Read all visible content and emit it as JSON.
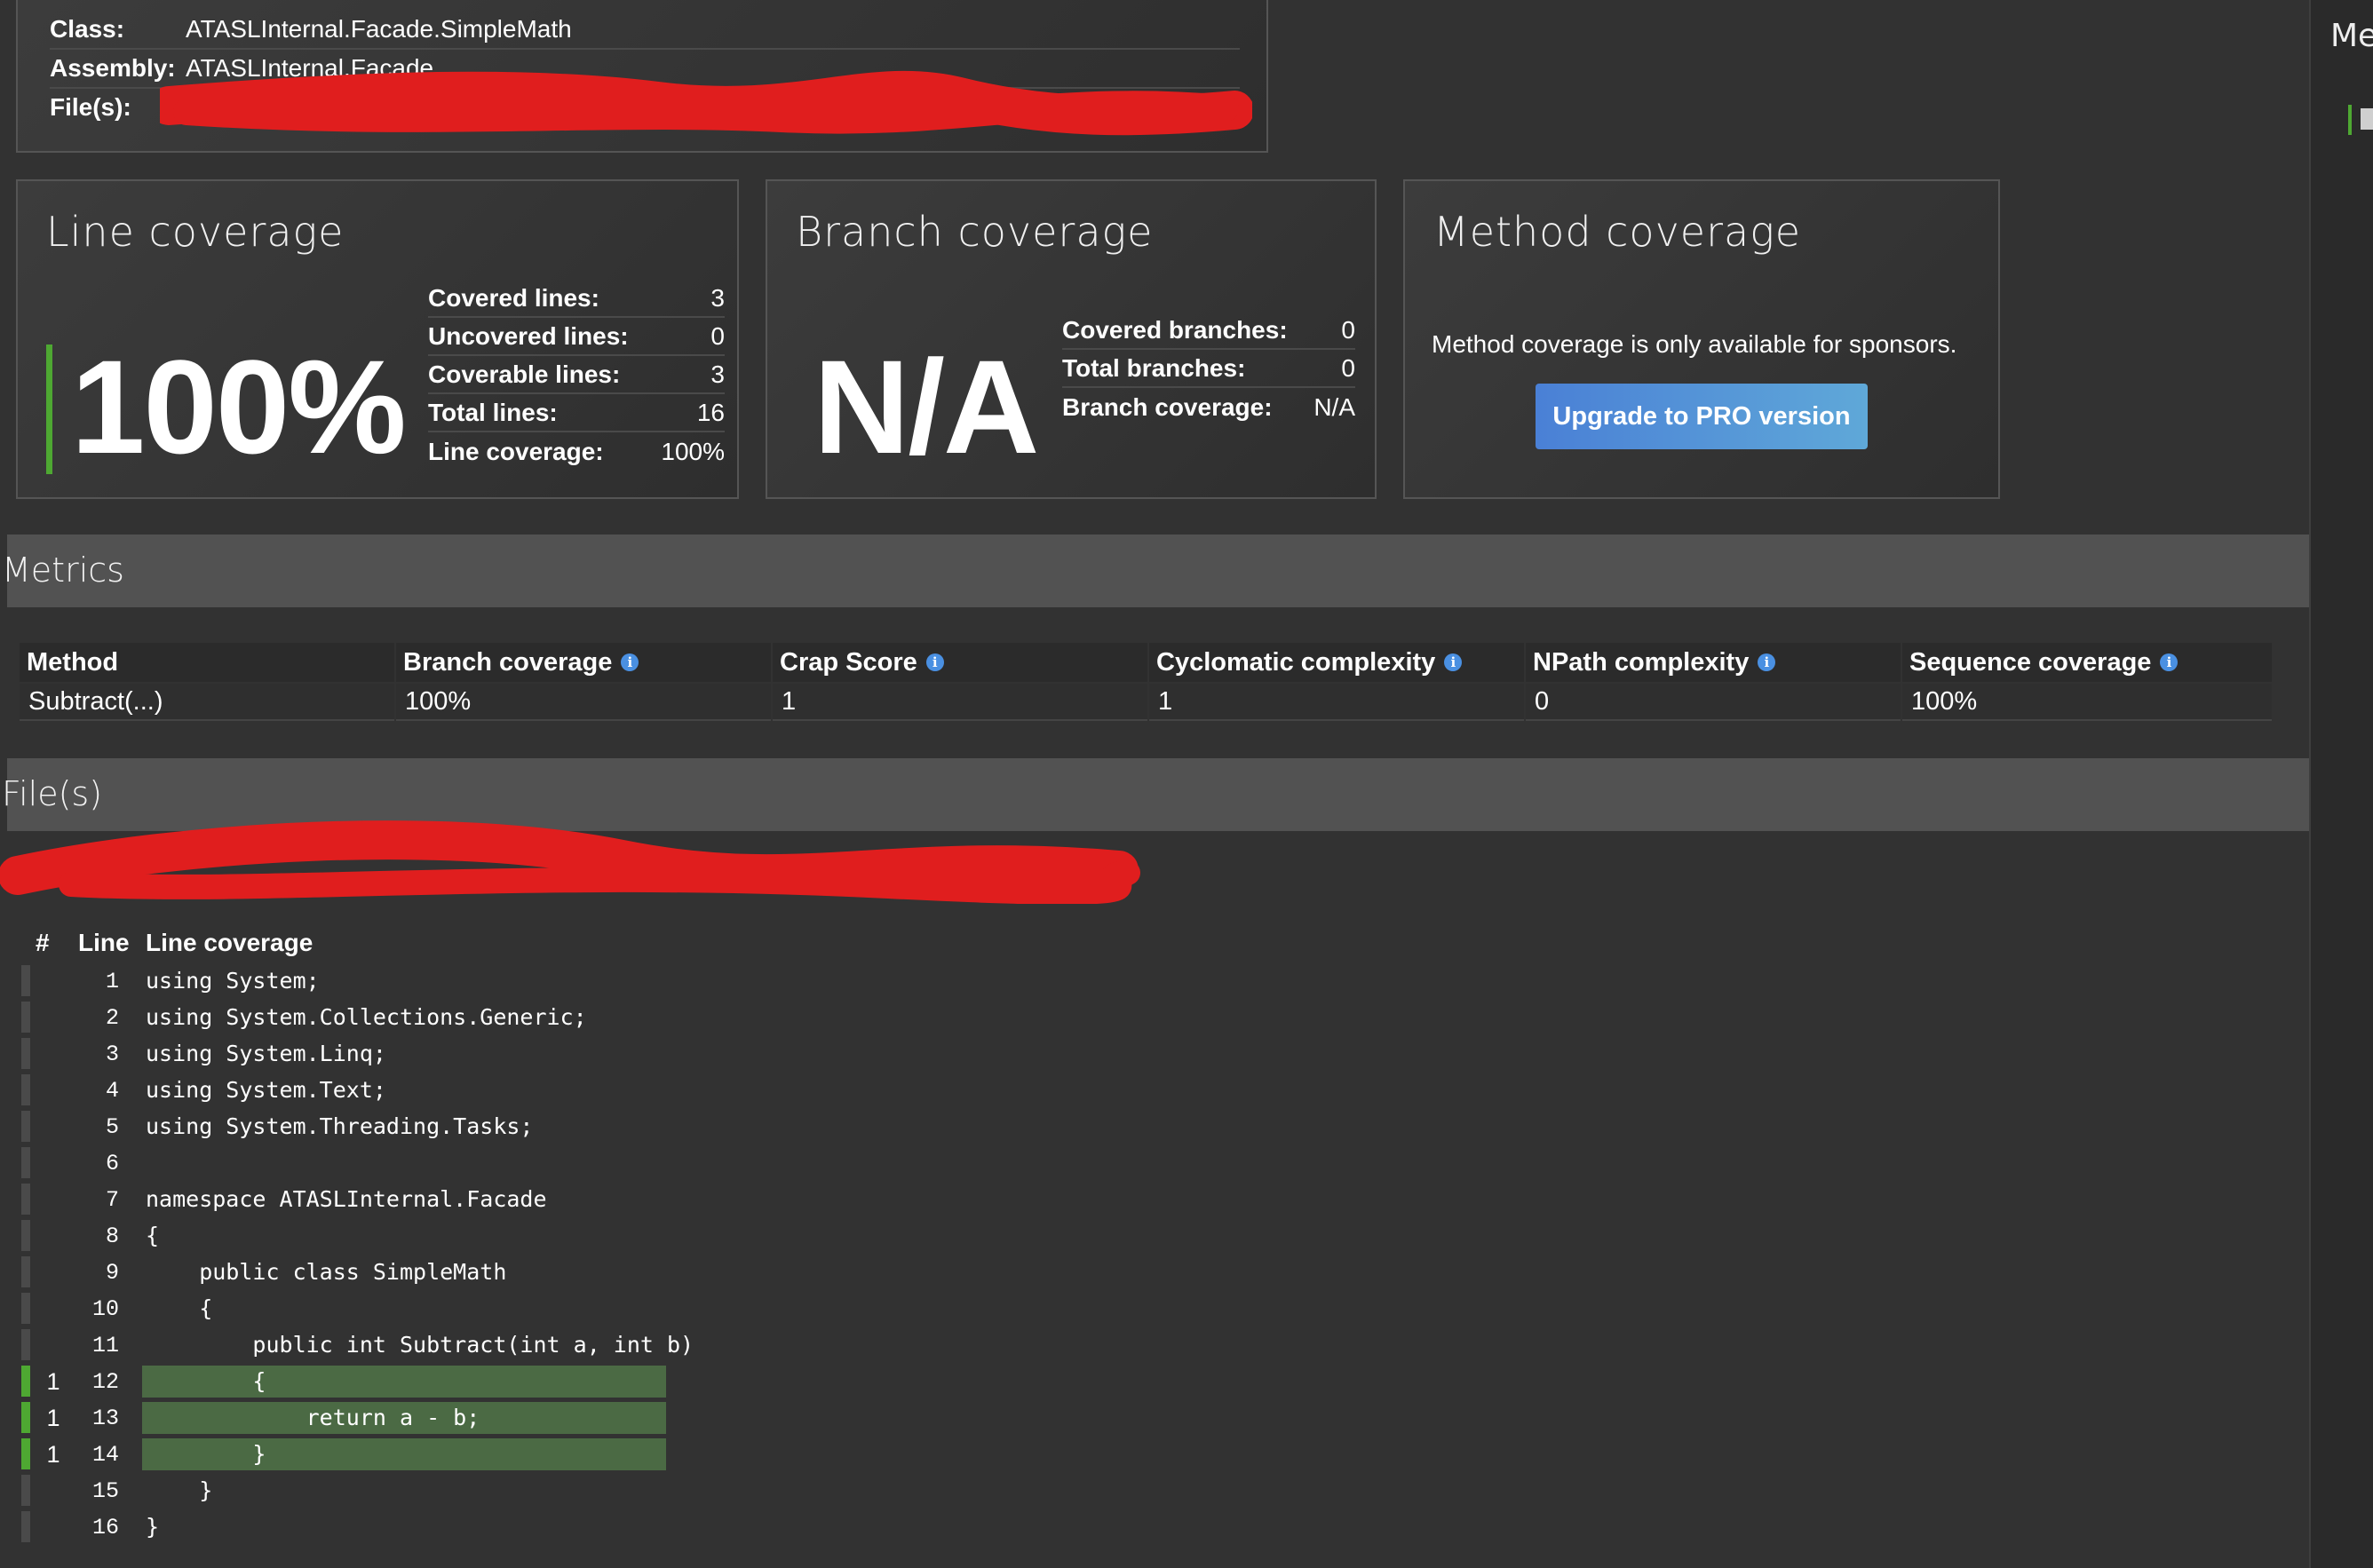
{
  "info": {
    "class_label": "Class:",
    "class_value": "ATASLInternal.Facade.SimpleMath",
    "assembly_label": "Assembly:",
    "assembly_value": "ATASLInternal.Facade",
    "files_label": "File(s):"
  },
  "line_coverage": {
    "title": "Line coverage",
    "big": "100%",
    "stats": [
      {
        "label": "Covered lines:",
        "value": "3"
      },
      {
        "label": "Uncovered lines:",
        "value": "0"
      },
      {
        "label": "Coverable lines:",
        "value": "3"
      },
      {
        "label": "Total lines:",
        "value": "16"
      },
      {
        "label": "Line coverage:",
        "value": "100%"
      }
    ]
  },
  "branch_coverage": {
    "title": "Branch coverage",
    "big": "N/A",
    "stats": [
      {
        "label": "Covered branches:",
        "value": "0"
      },
      {
        "label": "Total branches:",
        "value": "0"
      },
      {
        "label": "Branch coverage:",
        "value": "N/A"
      }
    ]
  },
  "method_coverage": {
    "title": "Method coverage",
    "message": "Method coverage is only available for sponsors.",
    "upgrade_button": "Upgrade to PRO version"
  },
  "metrics": {
    "section_title": "Metrics",
    "headers": [
      "Method",
      "Branch coverage",
      "Crap Score",
      "Cyclomatic complexity",
      "NPath complexity",
      "Sequence coverage"
    ],
    "rows": [
      [
        "Subtract(...)",
        "100%",
        "1",
        "1",
        "0",
        "100%"
      ]
    ]
  },
  "files": {
    "section_title": "File(s)",
    "col_hash": "#",
    "col_line": "Line",
    "col_coverage": "Line coverage",
    "lines": [
      {
        "hits": "",
        "line": "1",
        "code": "using System;",
        "covered": false
      },
      {
        "hits": "",
        "line": "2",
        "code": "using System.Collections.Generic;",
        "covered": false
      },
      {
        "hits": "",
        "line": "3",
        "code": "using System.Linq;",
        "covered": false
      },
      {
        "hits": "",
        "line": "4",
        "code": "using System.Text;",
        "covered": false
      },
      {
        "hits": "",
        "line": "5",
        "code": "using System.Threading.Tasks;",
        "covered": false
      },
      {
        "hits": "",
        "line": "6",
        "code": "",
        "covered": false
      },
      {
        "hits": "",
        "line": "7",
        "code": "namespace ATASLInternal.Facade",
        "covered": false
      },
      {
        "hits": "",
        "line": "8",
        "code": "{",
        "covered": false
      },
      {
        "hits": "",
        "line": "9",
        "code": "    public class SimpleMath",
        "covered": false
      },
      {
        "hits": "",
        "line": "10",
        "code": "    {",
        "covered": false
      },
      {
        "hits": "",
        "line": "11",
        "code": "        public int Subtract(int a, int b)",
        "covered": false
      },
      {
        "hits": "1",
        "line": "12",
        "code": "        {",
        "covered": true
      },
      {
        "hits": "1",
        "line": "13",
        "code": "            return a - b;",
        "covered": true
      },
      {
        "hits": "1",
        "line": "14",
        "code": "        }",
        "covered": true
      },
      {
        "hits": "",
        "line": "15",
        "code": "    }",
        "covered": false
      },
      {
        "hits": "",
        "line": "16",
        "code": "}",
        "covered": false
      }
    ]
  },
  "right_panel": {
    "label": "Me"
  },
  "colors": {
    "accent_green": "#4ea832",
    "covered_bg": "#4b6a44",
    "redaction": "#e01e1e",
    "button_blue": "#4a80d6"
  }
}
